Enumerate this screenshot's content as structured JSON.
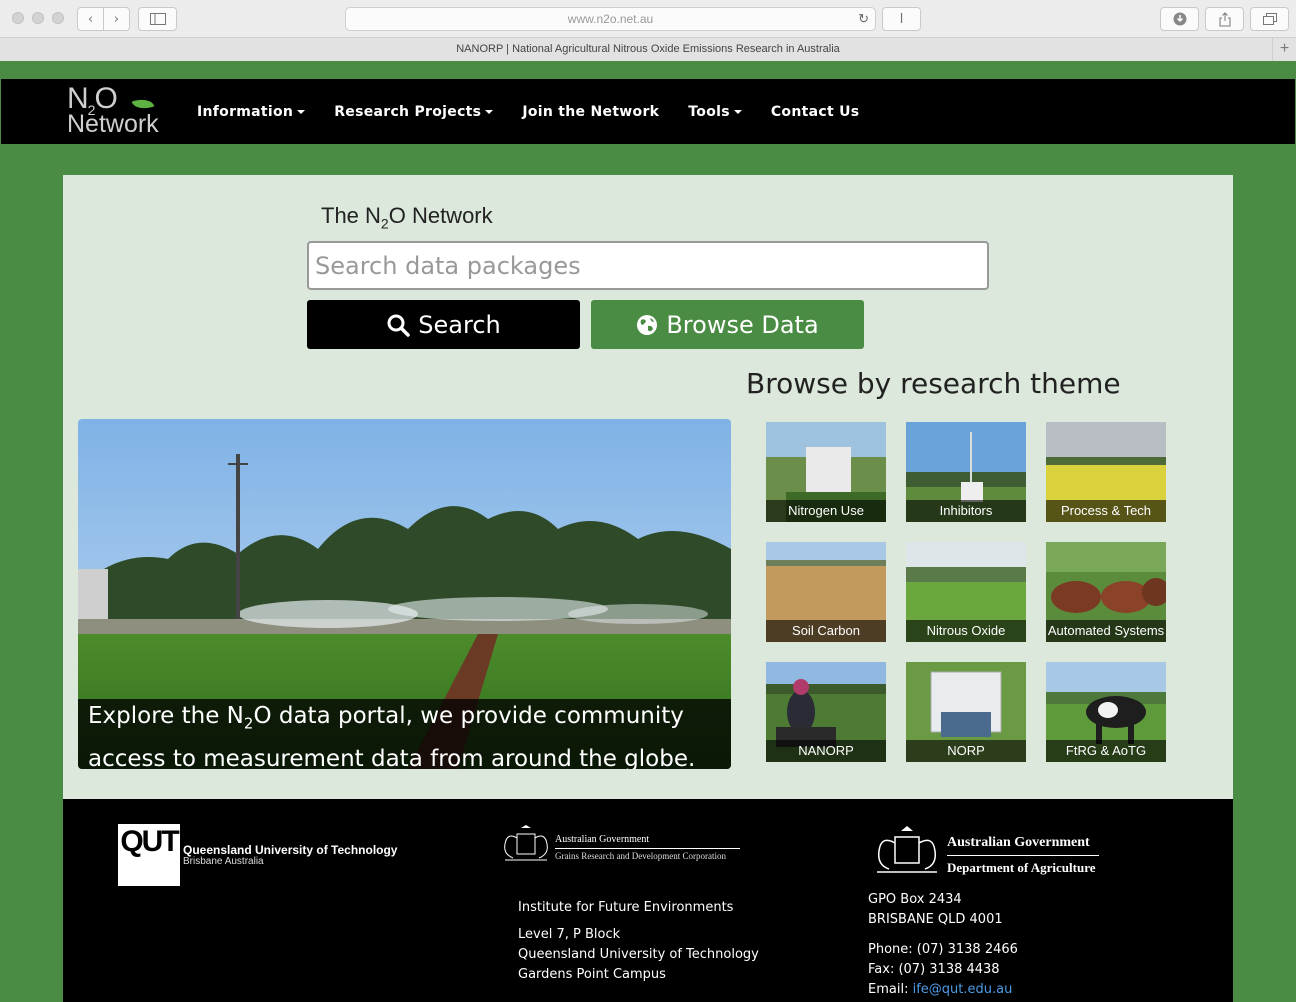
{
  "browser": {
    "url": "www.n2o.net.au",
    "tab_title": "NANORP | National Agricultural Nitrous Oxide Emissions Research in Australia"
  },
  "navbar": {
    "logo_line1": "N",
    "logo_sub": "2",
    "logo_line1b": "O",
    "logo_line2": "Network",
    "items": [
      {
        "label": "Information",
        "dropdown": true
      },
      {
        "label": "Research Projects",
        "dropdown": true
      },
      {
        "label": "Join the Network",
        "dropdown": false
      },
      {
        "label": "Tools",
        "dropdown": true
      },
      {
        "label": "Contact Us",
        "dropdown": false
      }
    ]
  },
  "main": {
    "title_pre": "The N",
    "title_sub": "2",
    "title_post": "O Network",
    "search_placeholder": "Search data packages",
    "search_button": "Search",
    "browse_button": "Browse Data",
    "theme_heading": "Browse by research theme",
    "hero_caption_pre": "Explore the N",
    "hero_caption_sub": "2",
    "hero_caption_post": "O data portal, we provide community access to measurement data from around the globe."
  },
  "themes": [
    {
      "label": "Nitrogen Use"
    },
    {
      "label": "Inhibitors"
    },
    {
      "label": "Process & Tech"
    },
    {
      "label": "Soil Carbon"
    },
    {
      "label": "Nitrous Oxide"
    },
    {
      "label": "Automated Systems"
    },
    {
      "label": "NANORP"
    },
    {
      "label": "NORP"
    },
    {
      "label": "FtRG & AoTG"
    }
  ],
  "footer": {
    "qut_logo": "QUT",
    "qut_name": "Queensland University of Technology",
    "qut_location": "Brisbane Australia",
    "grdc_line1": "Australian Government",
    "grdc_line2": "Grains Research and Development Corporation",
    "agri_line1": "Australian Government",
    "agri_line2": "Department of Agriculture",
    "institute": "Institute for Future Environments",
    "address": [
      "Level 7, P Block",
      "Queensland University of Technology",
      "Gardens Point Campus"
    ],
    "po_box": "GPO Box 2434",
    "city": "BRISBANE QLD 4001",
    "phone": "Phone: (07) 3138 2466",
    "fax": "Fax: (07) 3138 4438",
    "email_label": "Email:",
    "email": "ife@qut.edu.au"
  }
}
